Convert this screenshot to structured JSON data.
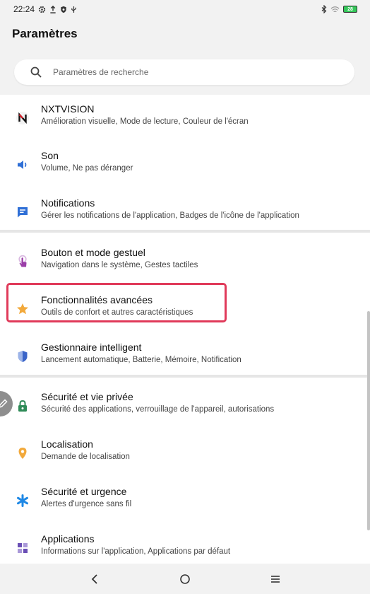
{
  "status_bar": {
    "time": "22:24",
    "battery_level": "28",
    "left_icons": [
      "gear-icon",
      "upload-icon",
      "shield-icon",
      "usb-icon"
    ],
    "right_icons": [
      "bluetooth-icon",
      "wifi-icon",
      "battery-icon"
    ]
  },
  "header": {
    "title": "Paramètres"
  },
  "search": {
    "placeholder": "Paramètres de recherche"
  },
  "items": [
    {
      "title": "NXTVISION",
      "subtitle": "Amélioration visuelle, Mode de lecture, Couleur de l'écran",
      "icon": "nxtvision-icon",
      "color": "#d8202a"
    },
    {
      "title": "Son",
      "subtitle": "Volume, Ne pas déranger",
      "icon": "speaker-icon",
      "color": "#2f6fd6"
    },
    {
      "title": "Notifications",
      "subtitle": "Gérer les notifications de l'application, Badges de l'icône de l'application",
      "icon": "notification-icon",
      "color": "#2f6fd6"
    },
    {
      "title": "Bouton et mode gestuel",
      "subtitle": "Navigation dans le système, Gestes tactiles",
      "icon": "gesture-icon",
      "color": "#9b3fa8"
    },
    {
      "title": "Fonctionnalités avancées",
      "subtitle": "Outils de confort et autres caractéristiques",
      "icon": "star-icon",
      "color": "#f2a93b"
    },
    {
      "title": "Gestionnaire intelligent",
      "subtitle": "Lancement automatique, Batterie, Mémoire, Notification",
      "icon": "shield-half-icon",
      "color": "#3a64c8"
    },
    {
      "title": "Sécurité et vie privée",
      "subtitle": "Sécurité des applications, verrouillage de l'appareil, autorisations",
      "icon": "lock-icon",
      "color": "#2e8b57"
    },
    {
      "title": "Localisation",
      "subtitle": "Demande de localisation",
      "icon": "location-pin-icon",
      "color": "#f2a93b"
    },
    {
      "title": "Sécurité et urgence",
      "subtitle": "Alertes d'urgence sans fil",
      "icon": "asterisk-icon",
      "color": "#1e88e5"
    },
    {
      "title": "Applications",
      "subtitle": "Informations sur l'application, Applications par défaut",
      "icon": "apps-grid-icon",
      "color": "#6a4fb5"
    }
  ],
  "nav_bar": {
    "buttons": [
      "back-icon",
      "home-icon",
      "recents-icon"
    ]
  },
  "colors": {
    "highlight": "#e03a5a",
    "background": "#f2f2f2"
  }
}
